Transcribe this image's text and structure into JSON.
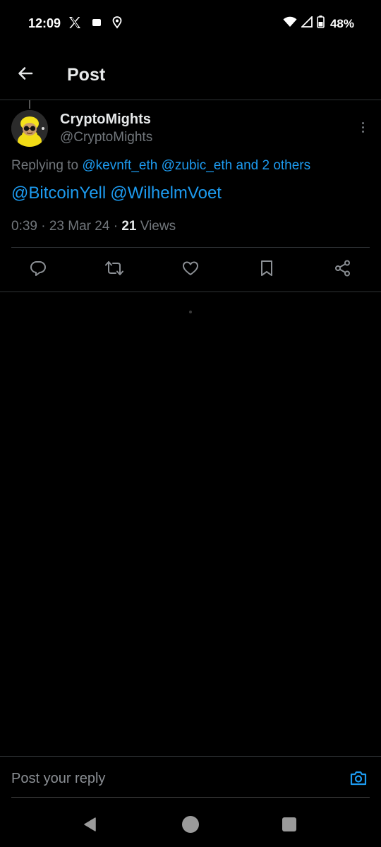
{
  "status_bar": {
    "time": "12:09",
    "left_icons": [
      "x-logo-icon",
      "square-notification-icon",
      "location-pin-icon"
    ],
    "right_icons": [
      "wifi-icon",
      "signal-icon",
      "battery-icon"
    ],
    "battery": "48%"
  },
  "header": {
    "title": "Post",
    "back_icon": "arrow-left-icon"
  },
  "post": {
    "display_name": "CryptoMights",
    "handle": "@CryptoMights",
    "replying_prefix": "Replying to",
    "replying_to": [
      "@kevnft_eth",
      "@zubic_eth"
    ],
    "replying_more": "and 2 others",
    "mentions": [
      "@BitcoinYell",
      "@WilhelmVoet"
    ],
    "timestamp": "0:39 · 23 Mar 24 ·",
    "views_count": "21",
    "views_label": "Views",
    "actions": [
      "reply-icon",
      "repost-icon",
      "like-icon",
      "bookmark-icon",
      "share-icon"
    ]
  },
  "reply_bar": {
    "placeholder": "Post your reply",
    "camera_icon": "camera-icon"
  },
  "nav_bar": {
    "buttons": [
      "back-triangle-icon",
      "home-circle-icon",
      "recents-square-icon"
    ]
  },
  "colors": {
    "background": "#000000",
    "accent": "#1d9bf0",
    "text_primary": "#e7e9ea",
    "text_secondary": "#71767b",
    "divider": "#2f3336"
  }
}
